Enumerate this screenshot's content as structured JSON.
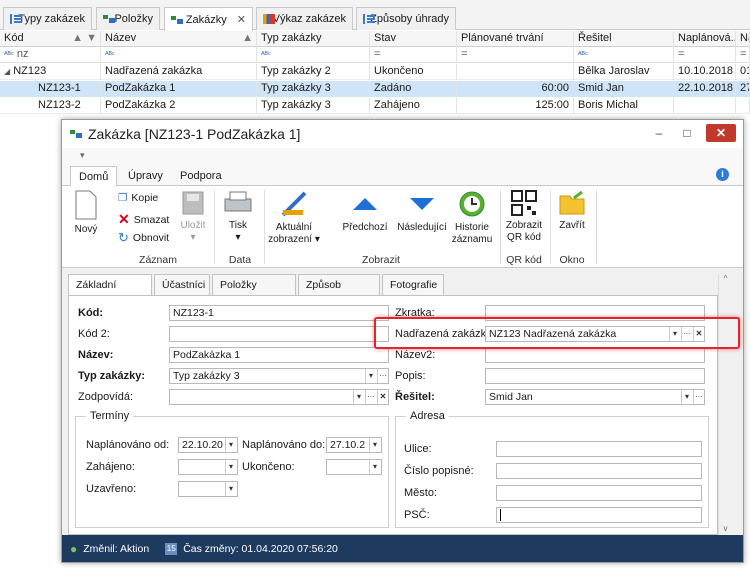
{
  "top_tabs": [
    {
      "label": "Typy zakázek",
      "icon": "list-icon"
    },
    {
      "label": "Položky",
      "icon": "items-icon"
    },
    {
      "label": "Zakázky",
      "icon": "tree-icon",
      "active": true,
      "closable": true
    },
    {
      "label": "Výkaz zakázek",
      "icon": "chart-icon"
    },
    {
      "label": "Způsoby úhrady",
      "icon": "list-icon"
    }
  ],
  "close_glyph": "✕",
  "grid": {
    "headers": [
      "Kód",
      "Název",
      "Typ zakázky",
      "Stav",
      "Plánované trvání",
      "Řešitel",
      "Naplánová...",
      "Na"
    ],
    "filter": [
      "nz",
      "",
      "",
      "=",
      "=",
      "",
      "=",
      "="
    ],
    "rows": [
      {
        "kod": "NZ123",
        "nazev": "Nadřazená zakázka",
        "typ": "Typ zakázky 2",
        "stav": "Ukončeno",
        "trvani": "",
        "resitel": "Bělka Jaroslav",
        "naplan": "10.10.2018",
        "na": "01"
      },
      {
        "kod": "NZ123-1",
        "nazev": "PodZakázka 1",
        "typ": "Typ zakázky 3",
        "stav": "Zadáno",
        "trvani": "60:00",
        "resitel": "Smid Jan",
        "naplan": "22.10.2018",
        "na": "27"
      },
      {
        "kod": "NZ123-2",
        "nazev": "PodZakázka 2",
        "typ": "Typ zakázky 3",
        "stav": "Zahájeno",
        "trvani": "125:00",
        "resitel": "Boris Michal",
        "naplan": "",
        "na": ""
      }
    ]
  },
  "dialog": {
    "title": "Zakázka [NZ123-1 PodZakázka 1]",
    "window_buttons": {
      "minimize": "–",
      "maximize": "□",
      "close": "✕"
    },
    "ribbon_tabs": [
      "Domů",
      "Úpravy",
      "Podpora"
    ],
    "ribbon": {
      "novy": "Nový",
      "kopie": "Kopie",
      "smazat": "Smazat",
      "obnovit": "Obnovit",
      "ulozit": "Uložit",
      "tisk": "Tisk",
      "aktualni": "Aktuální zobrazení",
      "predchozi": "Předchozí",
      "nasledujici": "Následující",
      "historie": "Historie záznamu",
      "qr": "Zobrazit QR kód",
      "zavrit": "Zavřít",
      "groups": [
        "Záznam",
        "Data",
        "Zobrazit",
        "QR kód",
        "Okno"
      ]
    },
    "form_tabs": [
      "Základní údaje",
      "Účastníci",
      "Položky zakázky",
      "Způsob úhrady",
      "Fotografie"
    ],
    "fields": {
      "kod_label": "Kód:",
      "kod": "NZ123-1",
      "kod2_label": "Kód 2:",
      "kod2": "",
      "nazev_label": "Název:",
      "nazev": "PodZakázka 1",
      "typ_label": "Typ zakázky:",
      "typ": "Typ zakázky 3",
      "zodpovida_label": "Zodpovídá:",
      "zodpovida": "",
      "zkratka_label": "Zkratka:",
      "zkratka": "",
      "nadrazena_label": "Nadřazená zakázka:",
      "nadrazena": "NZ123 Nadřazená zakázka",
      "nazev2_label": "Název2:",
      "nazev2": "",
      "popis_label": "Popis:",
      "popis": "",
      "resitel_label": "Řešitel:",
      "resitel": "Smid Jan"
    },
    "terminy": {
      "title": "Termíny",
      "naplanovano_od_label": "Naplánováno od:",
      "naplanovano_od": "22.10.20",
      "naplanovano_do_label": "Naplánováno do:",
      "naplanovano_do": "27.10.2",
      "zahajeno_label": "Zahájeno:",
      "zahajeno": "",
      "ukonceno_label": "Ukončeno:",
      "ukonceno": "",
      "uzavreno_label": "Uzavřeno:",
      "uzavreno": ""
    },
    "adresa": {
      "title": "Adresa",
      "ulice_label": "Ulice:",
      "cislo_label": "Číslo popisné:",
      "mesto_label": "Město:",
      "psc_label": "PSČ:"
    },
    "status": {
      "zmenil": "Změnil: Aktion",
      "cas": "Čas změny: 01.04.2020 07:56:20"
    },
    "highlight_color": "#e0262b"
  }
}
